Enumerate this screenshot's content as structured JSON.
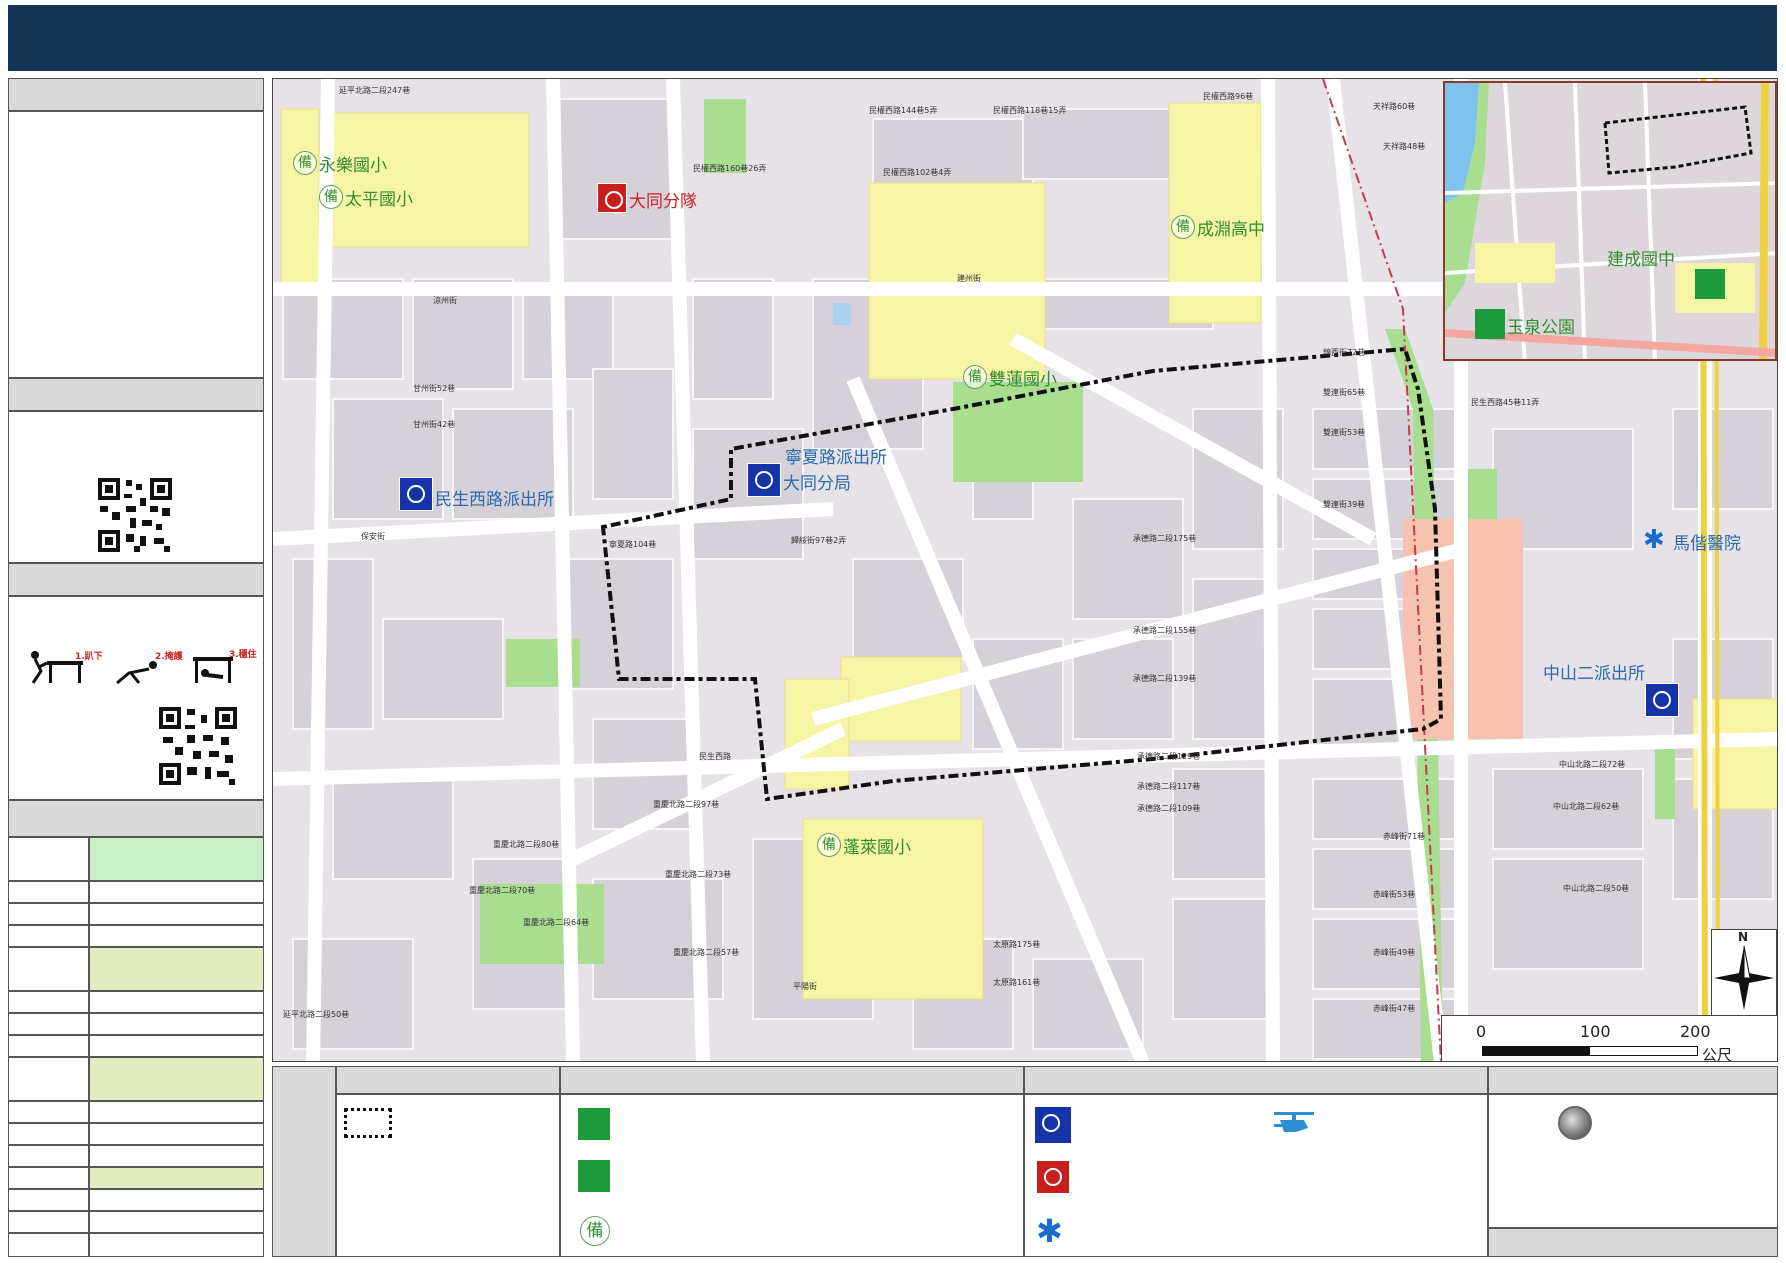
{
  "colors": {
    "header": "#143456",
    "panel_header": "#d9d9d9",
    "school": "#f8f4a6",
    "park": "#a9dd8f",
    "hospital": "#f6c3b0",
    "road": "#ffffff",
    "block": "#dcd6de",
    "green_cell": "#c9efc9",
    "khaki_cell": "#e1ecbf"
  },
  "sidebar": {
    "icons": [
      "qr-code-icon",
      "drop-icon",
      "cover-icon",
      "hold-icon",
      "qr-code-icon"
    ],
    "drill_steps": [
      "1.趴下",
      "2.掩護",
      "3.穩住"
    ]
  },
  "map": {
    "places": {
      "yongle": "永樂國小",
      "taiping": "太平國小",
      "datong_squad": "大同分隊",
      "chengyuan": "成淵高中",
      "shuanglian": "雙蓮國小",
      "ningxia_station": "寧夏路派出所",
      "datong_branch": "大同分局",
      "minsheng_station": "民生西路派出所",
      "penglai": "蓬萊國小",
      "mackay": "馬偕醫院",
      "zhongshan2": "中山二派出所",
      "jiancheng": "建成國中",
      "yuquan": "玉泉公園"
    },
    "streets": [
      {
        "text": "延平北路二段247巷"
      },
      {
        "text": "民權西路144巷5弄"
      },
      {
        "text": "民權西路118巷15弄"
      },
      {
        "text": "民權西路96巷"
      },
      {
        "text": "天祥路60巷"
      },
      {
        "text": "天祥路48巷"
      },
      {
        "text": "民權西路160巷26弄"
      },
      {
        "text": "民權西路102巷4弄"
      },
      {
        "text": "涼州街"
      },
      {
        "text": "建州街"
      },
      {
        "text": "甘州街52巷"
      },
      {
        "text": "甘州街42巷"
      },
      {
        "text": "保安街"
      },
      {
        "text": "錦西街72巷"
      },
      {
        "text": "雙連街65巷"
      },
      {
        "text": "雙連街53巷"
      },
      {
        "text": "民生西路45巷11弄"
      },
      {
        "text": "寧夏路104巷"
      },
      {
        "text": "歸綏街97巷2弄"
      },
      {
        "text": "承德路二段175巷"
      },
      {
        "text": "雙連街39巷"
      },
      {
        "text": "承德路二段155巷"
      },
      {
        "text": "承德路二段139巷"
      },
      {
        "text": "民生西路"
      },
      {
        "text": "中山北路二段72巷"
      },
      {
        "text": "中山北路二段62巷"
      },
      {
        "text": "承德路二段129巷"
      },
      {
        "text": "承德路二段117巷"
      },
      {
        "text": "承德路二段109巷"
      },
      {
        "text": "重慶北路二段97巷"
      },
      {
        "text": "重慶北路二段80巷"
      },
      {
        "text": "重慶北路二段73巷"
      },
      {
        "text": "重慶北路二段70巷"
      },
      {
        "text": "重慶北路二段64巷"
      },
      {
        "text": "重慶北路二段57巷"
      },
      {
        "text": "太原路175巷"
      },
      {
        "text": "太原路161巷"
      },
      {
        "text": "平陽街"
      },
      {
        "text": "赤峰街71巷"
      },
      {
        "text": "赤峰街53巷"
      },
      {
        "text": "赤峰街49巷"
      },
      {
        "text": "赤峰街47巷"
      },
      {
        "text": "中山北路二段50巷"
      },
      {
        "text": "延平北路二段50巷"
      }
    ],
    "scale": {
      "ticks": [
        "0",
        "100",
        "200"
      ],
      "unit": "公尺"
    },
    "north": "N"
  },
  "legend": {
    "icons": [
      "boundary-icon",
      "shelter-icon",
      "park-shelter-icon",
      "bei-icon",
      "police-icon",
      "fire-squad-icon",
      "hospital-icon",
      "helicopter-icon",
      "gray-circle-icon"
    ]
  }
}
